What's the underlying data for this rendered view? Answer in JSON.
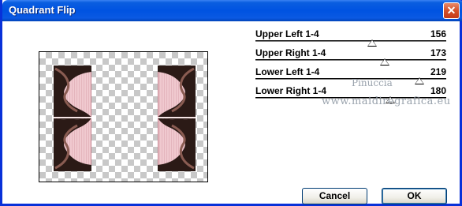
{
  "window": {
    "title": "Quadrant Flip",
    "close_glyph": "✕"
  },
  "sliders": [
    {
      "label": "Upper Left 1-4",
      "value": "156",
      "level": 156,
      "max": 255
    },
    {
      "label": "Upper Right 1-4",
      "value": "173",
      "level": 173,
      "max": 255
    },
    {
      "label": "Lower Left 1-4",
      "value": "219",
      "level": 219,
      "max": 255
    },
    {
      "label": "Lower Right 1-4",
      "value": "180",
      "level": 180,
      "max": 255
    }
  ],
  "watermark": {
    "line1": "Pinuccia",
    "line2": "www.maidiregrafica.eu"
  },
  "buttons": {
    "cancel": "Cancel",
    "ok": "OK"
  },
  "colors": {
    "titlebar": "#0053e1",
    "strip_pink": "#f0c9cf"
  }
}
